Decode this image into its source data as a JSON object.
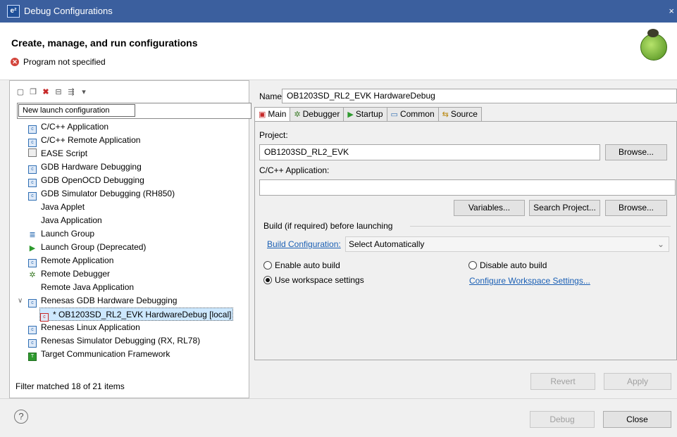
{
  "window": {
    "title": "Debug Configurations",
    "app_icon_text": "e²",
    "close_glyph": "×"
  },
  "header": {
    "heading": "Create, manage, and run configurations",
    "error_message": "Program not specified"
  },
  "left": {
    "toolbar_icons": [
      "new-config-icon",
      "duplicate-icon",
      "delete-icon",
      "collapse-all-icon",
      "filter-icon",
      "view-menu-icon"
    ],
    "tooltip": "New launch configuration",
    "tree": [
      {
        "label": "C/C++ Application",
        "icon": "c-app-icon"
      },
      {
        "label": "C/C++ Remote Application",
        "icon": "c-remote-icon"
      },
      {
        "label": "EASE Script",
        "icon": "script-icon"
      },
      {
        "label": "GDB Hardware Debugging",
        "icon": "gdb-hw-icon"
      },
      {
        "label": "GDB OpenOCD Debugging",
        "icon": "gdb-openocd-icon"
      },
      {
        "label": "GDB Simulator Debugging (RH850)",
        "icon": "gdb-sim-icon"
      },
      {
        "label": "Java Applet",
        "icon": ""
      },
      {
        "label": "Java Application",
        "icon": ""
      },
      {
        "label": "Launch Group",
        "icon": "launch-group-icon"
      },
      {
        "label": "Launch Group (Deprecated)",
        "icon": "run-icon"
      },
      {
        "label": "Remote Application",
        "icon": "remote-app-icon"
      },
      {
        "label": "Remote Debugger",
        "icon": "remote-debugger-icon"
      },
      {
        "label": "Remote Java Application",
        "icon": ""
      },
      {
        "label": "Renesas GDB Hardware Debugging",
        "icon": "renesas-gdb-icon"
      },
      {
        "label": "* OB1203SD_RL2_EVK HardwareDebug [local]",
        "icon": "config-icon"
      },
      {
        "label": "Renesas Linux Application",
        "icon": "linux-app-icon"
      },
      {
        "label": "Renesas Simulator Debugging (RX, RL78)",
        "icon": "simulator-icon"
      },
      {
        "label": "Target Communication Framework",
        "icon": "tcf-icon"
      }
    ],
    "filter_status": "Filter matched 18 of 21 items"
  },
  "right": {
    "name_label": "Name:",
    "name_value": "OB1203SD_RL2_EVK HardwareDebug",
    "tabs": [
      {
        "label": "Main",
        "icon": "main-tab-icon"
      },
      {
        "label": "Debugger",
        "icon": "debugger-tab-icon"
      },
      {
        "label": "Startup",
        "icon": "startup-tab-icon"
      },
      {
        "label": "Common",
        "icon": "common-tab-icon"
      },
      {
        "label": "Source",
        "icon": "source-tab-icon"
      }
    ],
    "project_label": "Project:",
    "project_value": "OB1203SD_RL2_EVK",
    "browse_label": "Browse...",
    "app_label": "C/C++ Application:",
    "app_value": "",
    "variables_label": "Variables...",
    "search_project_label": "Search Project...",
    "build_group_label": "Build (if required) before launching",
    "build_config_link": "Build Configuration:",
    "build_config_value": "Select Automatically",
    "enable_auto_build": "Enable auto build",
    "disable_auto_build": "Disable auto build",
    "use_workspace": "Use workspace settings",
    "configure_workspace": "Configure Workspace Settings...",
    "revert_label": "Revert",
    "apply_label": "Apply"
  },
  "footer": {
    "help": "?",
    "debug_label": "Debug",
    "close_label": "Close"
  }
}
